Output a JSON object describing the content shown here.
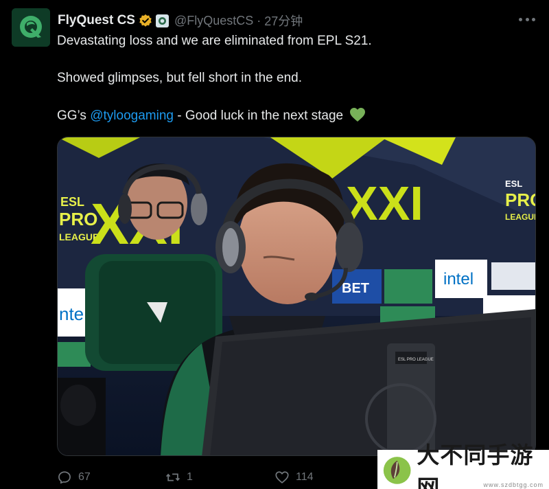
{
  "tweet": {
    "display_name": "FlyQuest CS",
    "handle": "@FlyQuestCS",
    "separator": "·",
    "time": "27分钟",
    "lines": {
      "line1": "Devastating loss and we are eliminated from EPL S21.",
      "line2": "Showed glimpses, but fell short in the end.",
      "line3_prefix": "GG’s ",
      "line3_mention": "@tyloogaming",
      "line3_suffix": " - Good luck in the next stage"
    },
    "image_texts": {
      "banner_left": [
        "ESL",
        "PRO",
        "LEAGUE"
      ],
      "banner_numeral": "XXI",
      "sponsor_intel": "intel",
      "sponsor_bet": "BET",
      "monitor_label": "ESL PRO LEAGUE"
    }
  },
  "actions": {
    "replies": "67",
    "reposts": "1",
    "likes": "114"
  },
  "icons": {
    "avatar": "flyquest-logo-icon",
    "verified": "verified-badge-icon",
    "more": "more-icon",
    "reply": "reply-icon",
    "repost": "repost-icon",
    "like": "like-icon"
  },
  "colors": {
    "background": "#000000",
    "text": "#e7e9ea",
    "muted": "#71767b",
    "link": "#1d9bf0",
    "verified": "#e8b027",
    "brand_green": "#0e3b26"
  },
  "watermark": {
    "title": "大不同手游网",
    "url": "www.szdbtgg.com"
  }
}
